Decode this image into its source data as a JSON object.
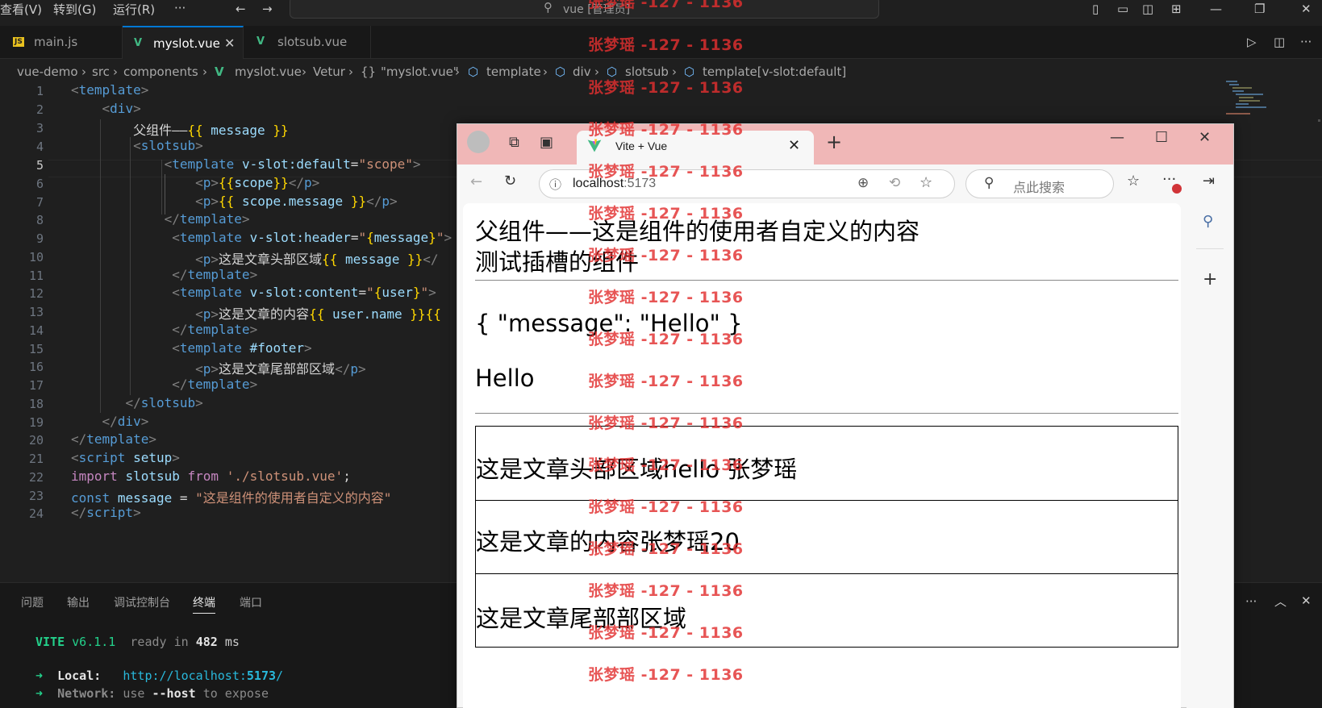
{
  "menu": {
    "view": "查看(V)",
    "goto": "转到(G)",
    "run": "运行(R)",
    "more": "···"
  },
  "command_center": {
    "text": "vue [管理员]"
  },
  "editor_tabs": [
    {
      "label": "main.js",
      "icon": "JS"
    },
    {
      "label": "myslot.vue",
      "icon": "V"
    },
    {
      "label": "slotsub.vue",
      "icon": "V"
    }
  ],
  "breadcrumb": [
    "vue-demo",
    "src",
    "components",
    "myslot.vue",
    "Vetur",
    "\"myslot.vue\"",
    "template",
    "div",
    "slotsub",
    "template[v-slot:default]"
  ],
  "line_numbers": [
    "1",
    "2",
    "3",
    "4",
    "5",
    "6",
    "7",
    "8",
    "9",
    "10",
    "11",
    "12",
    "13",
    "14",
    "15",
    "16",
    "17",
    "18",
    "19",
    "20",
    "21",
    "22",
    "23",
    "24"
  ],
  "code": {
    "l3_text": "父组件——",
    "l10_text": "这是文章头部区域",
    "l13_text": "这是文章的内容",
    "l16_text": "这是文章尾部部区域",
    "l22_path": "'./slotsub.vue'",
    "l23_value": "\"这是组件的使用者自定义的内容\""
  },
  "panel": {
    "tabs": [
      "问题",
      "输出",
      "调试控制台",
      "终端",
      "端口"
    ],
    "active_tab": "终端",
    "vite": "VITE",
    "version": "v6.1.1",
    "ready": "ready in",
    "ms_value": "482",
    "ms": "ms",
    "local_label": "Local:",
    "local_url_prefix": "http://localhost:",
    "local_port": "5173",
    "local_url_suffix": "/",
    "network_label": "Network:",
    "network_use": "use",
    "network_host": "--host",
    "network_expose": "to expose"
  },
  "browser": {
    "tab_title": "Vite + Vue",
    "host": "localhost",
    "port": ":5173",
    "search_placeholder": "点此搜索",
    "content": {
      "line1": "父组件——这是组件的使用者自定义的内容",
      "line2": "测试插槽的组件",
      "scope": "{ \"message\": \"Hello\" }",
      "hello": "Hello",
      "header": "这是文章头部区域hello 张梦瑶",
      "content": "这是文章的内容张梦瑶20",
      "footer": "这是文章尾部部区域"
    }
  },
  "watermark": "张梦瑶 -127 - 1136",
  "colors": {
    "accent": "#0078d4",
    "vue_green": "#41b883",
    "browser_titlebar": "#f0b7b7",
    "watermark": "#e23030"
  }
}
